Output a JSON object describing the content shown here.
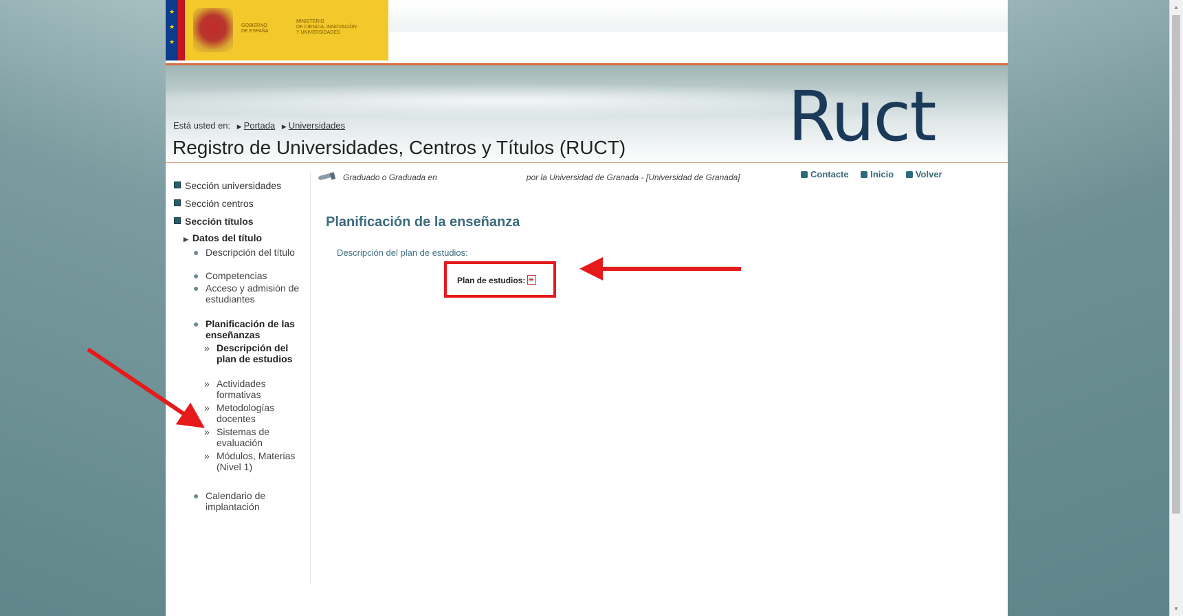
{
  "gov_header": {
    "gov_name": "GOBIERNO\nDE ESPAÑA",
    "ministry_name": "MINISTERIO\nDE CIENCIA, INNOVACIÓN\nY UNIVERSIDADES"
  },
  "logo_text": "Ruct",
  "breadcrumb": {
    "prefix": "Está usted en:",
    "items": [
      "Portada",
      "Universidades"
    ]
  },
  "page_title": "Registro de Universidades, Centros y Títulos (RUCT)",
  "top_links": [
    "Contacte",
    "Inicio",
    "Volver"
  ],
  "course_line": {
    "left": "Graduado o Graduada en",
    "right": "por la Universidad de Granada - [Universidad de Granada]"
  },
  "sidebar": {
    "sections": [
      "Sección universidades",
      "Sección centros",
      "Sección títulos"
    ],
    "subsection": "Datos del título",
    "items": [
      "Descripción del título",
      "Competencias",
      "Acceso y admisión de estudiantes",
      "Planificación de las enseñanzas",
      "Calendario de implantación"
    ],
    "subitems": [
      "Descripción del plan de estudios",
      "Actividades formativas",
      "Metodologías docentes",
      "Sistemas de evaluación",
      "Módulos, Materias (Nivel 1)"
    ]
  },
  "main": {
    "section_title": "Planificación de la enseñanza",
    "plan_description_label": "Descripción del plan de estudios:",
    "plan_label": "Plan de estudios:"
  },
  "colors": {
    "annotation_red": "#e51b1b",
    "title_teal": "#3b6b7d",
    "header_rule": "#d86a3b"
  }
}
